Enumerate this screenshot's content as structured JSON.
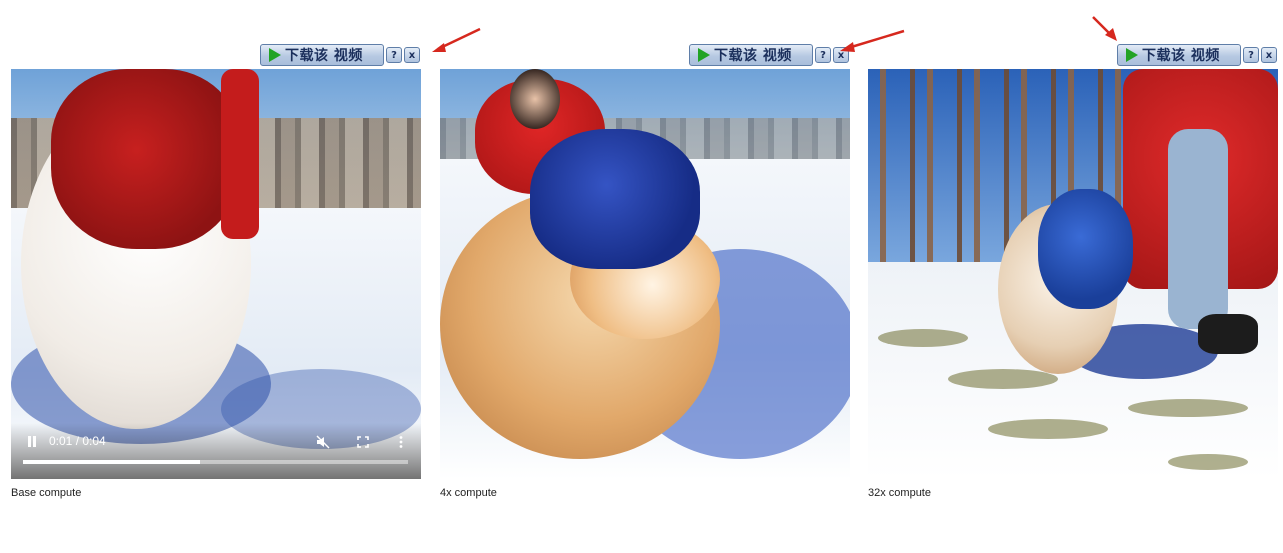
{
  "download_toolbar": {
    "button_label": "下载该 视频",
    "help_label": "?",
    "close_label": "x"
  },
  "colors": {
    "arrow": "#d6281e",
    "toolbar_bg": "#b7c9e2",
    "play_green": "#22a324"
  },
  "panels": [
    {
      "caption": "Base compute",
      "player": {
        "time": "0:01 / 0:04",
        "progress": 0.46,
        "icons": [
          "pause-icon",
          "mute-icon",
          "fullscreen-icon",
          "more-options-icon"
        ]
      }
    },
    {
      "caption": "4x compute"
    },
    {
      "caption": "32x compute"
    }
  ]
}
